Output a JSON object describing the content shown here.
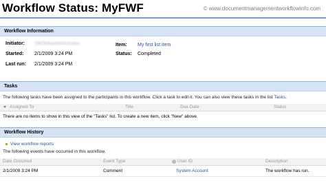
{
  "page": {
    "title": "Workflow Status: MyFWF",
    "watermark": "© www.documentmanagementworkflowinfo.com"
  },
  "info": {
    "header": "Workflow Information",
    "initiator_label": "Initiator:",
    "initiator_value": "VM2K8\\administrator",
    "started_label": "Started:",
    "started_value": "2/1/2009 3:24 PM",
    "lastrun_label": "Last run:",
    "lastrun_value": "2/1/2009 3:24 PM",
    "item_label": "Item:",
    "item_value": "My first list item",
    "status_label": "Status:",
    "status_value": "Completed"
  },
  "tasks": {
    "header": "Tasks",
    "desc_prefix": "The following tasks have been assigned to the participants in this workflow. Click a task to edit it. You can also view these tasks in the list",
    "desc_link": "Tasks",
    "desc_suffix": ".",
    "columns": [
      "Assigned To",
      "Title",
      "Due Date",
      "Status"
    ],
    "empty": "There are no items to show in this view of the \"Tasks\" list. To create a new item, click \"New\" above."
  },
  "history": {
    "header": "Workflow History",
    "reports_link": "View workflow reports",
    "desc": "The following events have occurred in this workflow.",
    "columns": [
      "Date Occurred",
      "Event Type",
      "User ID",
      "Description"
    ],
    "rows": [
      {
        "date": "2/1/2009 3:24 PM",
        "event": "Comment",
        "user": "System Account",
        "description": "The workflow has run."
      }
    ]
  }
}
